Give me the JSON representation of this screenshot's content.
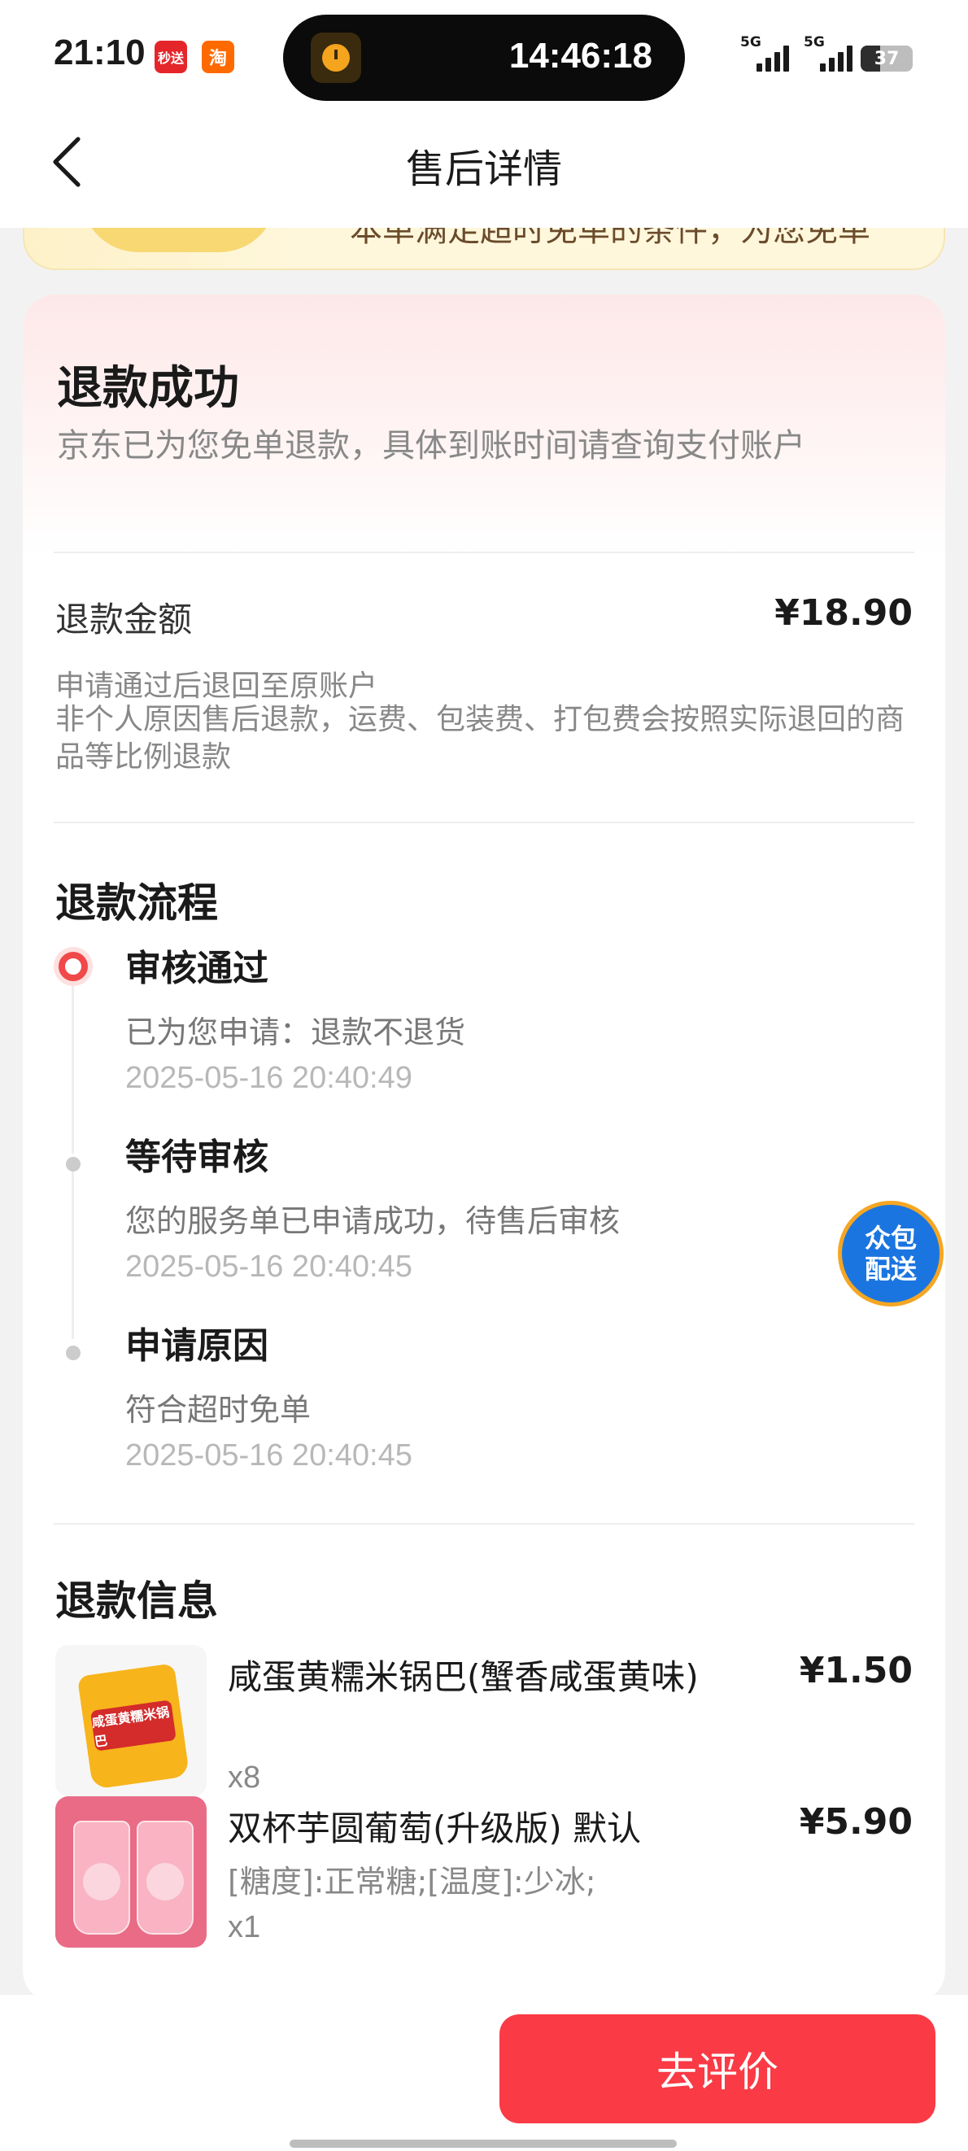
{
  "status_bar": {
    "time": "21:10",
    "app_badge_1": "秒送",
    "app_badge_2": "淘",
    "island_time": "14:46:18",
    "signal_1": "5G",
    "signal_2": "5G",
    "battery": "37",
    "battery_level": 0.37
  },
  "nav": {
    "title": "售后详情"
  },
  "banner": {
    "text": "本单满足超时免单的条件，为您免单"
  },
  "refund": {
    "status": "退款成功",
    "description": "京东已为您免单退款，具体到账时间请查询支付账户",
    "amount_label": "退款金额",
    "amount_value": "¥18.90",
    "note_1": "申请通过后退回至原账户",
    "note_2": "非个人原因售后退款，运费、包装费、打包费会按照实际退回的商品等比例退款"
  },
  "flow": {
    "title": "退款流程",
    "steps": [
      {
        "title": "审核通过",
        "desc": "已为您申请：退款不退货",
        "time": "2025-05-16 20:40:49"
      },
      {
        "title": "等待审核",
        "desc": "您的服务单已申请成功，待售后审核",
        "time": "2025-05-16 20:40:45"
      },
      {
        "title": "申请原因",
        "desc": "符合超时免单",
        "time": "2025-05-16 20:40:45"
      }
    ]
  },
  "info": {
    "title": "退款信息",
    "items": [
      {
        "name": "咸蛋黄糯米锅巴(蟹香咸蛋黄味)",
        "price": "¥1.50",
        "spec": "",
        "qty": "x8",
        "thumb_text": "咸蛋黄糯米锅巴"
      },
      {
        "name": "双杯芋圆葡萄(升级版) 默认",
        "price": "¥5.90",
        "spec": "[糖度]:正常糖;[温度]:少冰;",
        "qty": "x1"
      }
    ]
  },
  "float_badge": {
    "line1": "众包",
    "line2": "配送"
  },
  "bottom": {
    "review_button": "去评价"
  },
  "colors": {
    "accent": "#fa3a45",
    "timeline_active": "#f0494a",
    "badge_blue": "#1b75e0"
  }
}
